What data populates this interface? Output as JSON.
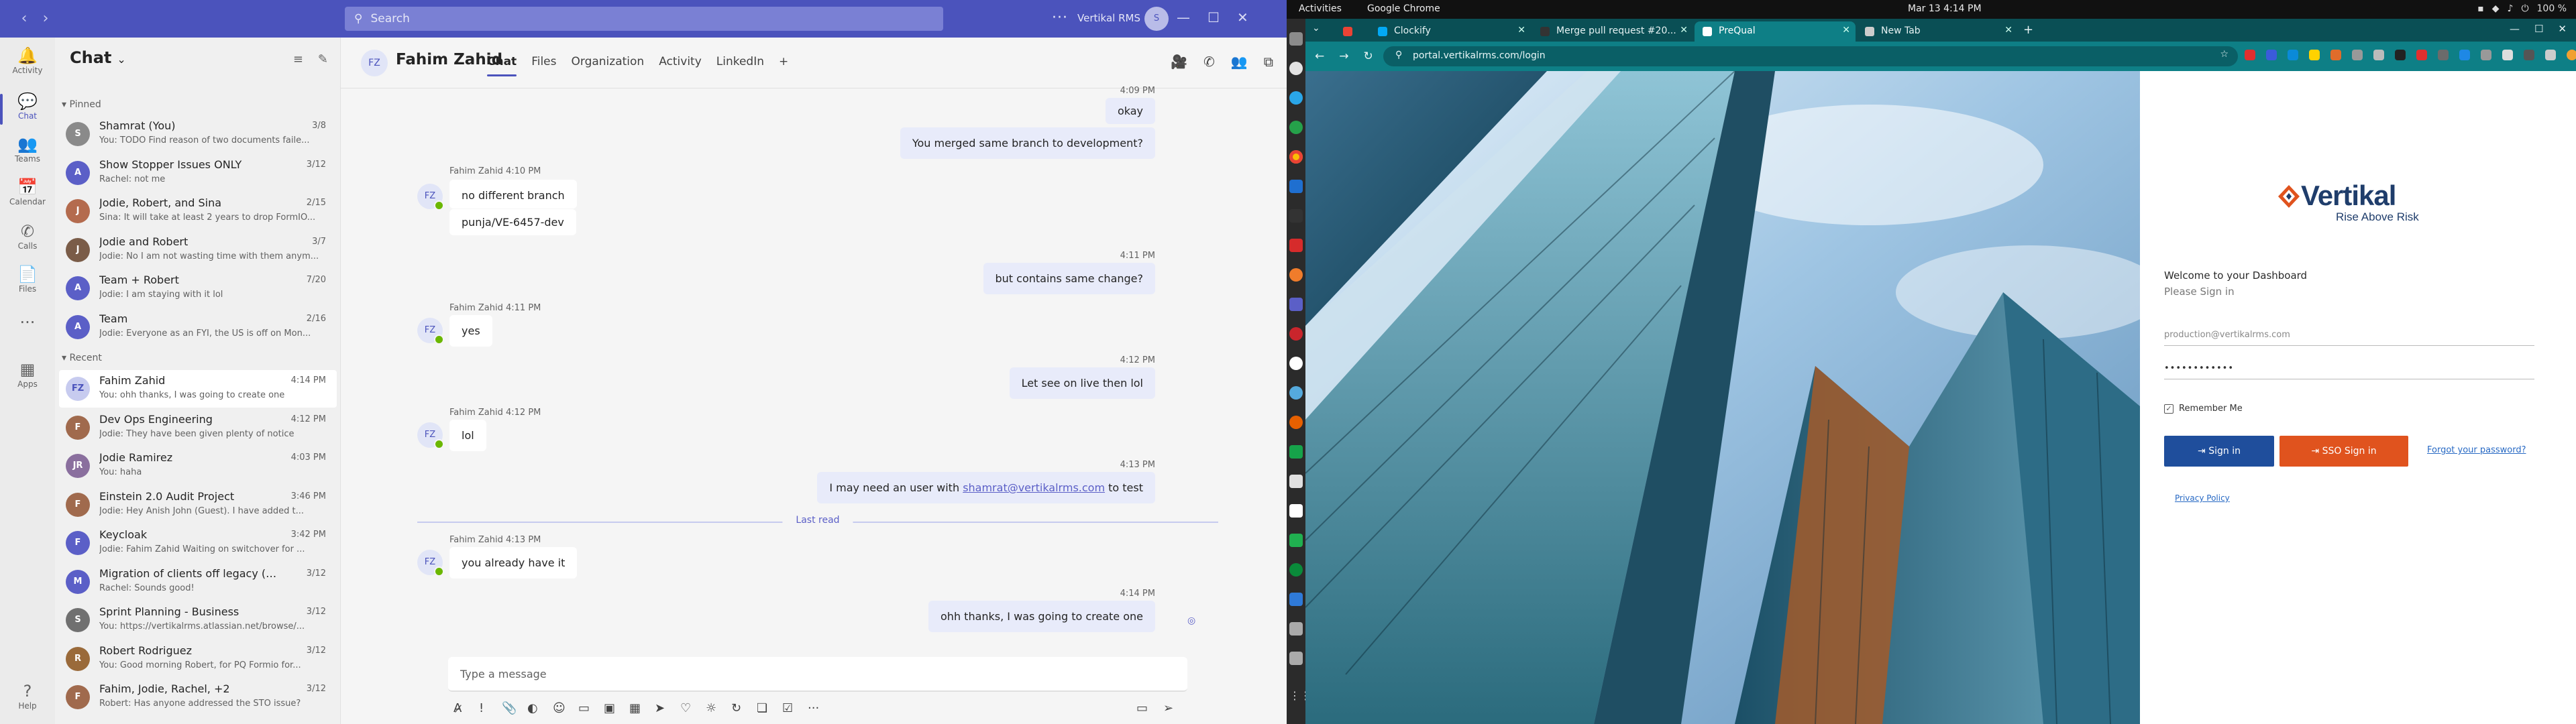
{
  "teams": {
    "search_placeholder": "Search",
    "org_name": "Vertikal RMS",
    "more": "···",
    "rail": [
      {
        "label": "Activity",
        "icon": "bell-icon"
      },
      {
        "label": "Chat",
        "icon": "chat-icon"
      },
      {
        "label": "Teams",
        "icon": "teams-icon"
      },
      {
        "label": "Calendar",
        "icon": "calendar-icon"
      },
      {
        "label": "Calls",
        "icon": "phone-icon"
      },
      {
        "label": "Files",
        "icon": "file-icon"
      },
      {
        "label": "",
        "icon": "more-icon"
      },
      {
        "label": "Apps",
        "icon": "apps-icon"
      },
      {
        "label": "Help",
        "icon": "help-icon"
      }
    ],
    "list_title": "Chat",
    "pinned_label": "Pinned",
    "recent_label": "Recent",
    "pinned": [
      {
        "name": "Shamrat (You)",
        "time": "3/8",
        "preview": "You: TODO Find reason of two documents faile...",
        "avatar": "S",
        "color": "#8a8a8a"
      },
      {
        "name": "Show Stopper Issues ONLY",
        "time": "3/12",
        "preview": "Rachel: not me",
        "avatar": "A",
        "color": "#5b5fc7"
      },
      {
        "name": "Jodie, Robert, and Sina",
        "time": "2/15",
        "preview": "Sina: It will take at least 2 years to drop FormIO...",
        "avatar": "J",
        "color": "#b46b4e"
      },
      {
        "name": "Jodie and Robert",
        "time": "3/7",
        "preview": "Jodie: No I am not wasting time with them anym...",
        "avatar": "J",
        "color": "#7a5c48"
      },
      {
        "name": "Team + Robert",
        "time": "7/20",
        "preview": "Jodie: I am staying with it lol",
        "avatar": "A",
        "color": "#5b5fc7"
      },
      {
        "name": "Team",
        "time": "2/16",
        "preview": "Jodie: Everyone as an FYI, the US is off on Mon...",
        "avatar": "A",
        "color": "#5b5fc7"
      }
    ],
    "recent": [
      {
        "name": "Fahim Zahid",
        "time": "4:14 PM",
        "preview": "You: ohh thanks, I was going to create one",
        "avatar": "FZ",
        "color": "#c7cbef",
        "selected": true
      },
      {
        "name": "Dev Ops Engineering",
        "time": "4:12 PM",
        "preview": "Jodie: They have been given plenty of notice",
        "avatar": "F",
        "color": "#a06a4d"
      },
      {
        "name": "Jodie Ramirez",
        "time": "4:03 PM",
        "preview": "You: haha",
        "avatar": "JR",
        "color": "#8a6f9e"
      },
      {
        "name": "Einstein 2.0 Audit Project",
        "time": "3:46 PM",
        "preview": "Jodie: Hey Anish John (Guest). I have added t...",
        "avatar": "F",
        "color": "#a06a4d"
      },
      {
        "name": "Keycloak",
        "time": "3:42 PM",
        "preview": "Jodie: Fahim Zahid Waiting on switchover for ...",
        "avatar": "F",
        "color": "#5b5fc7"
      },
      {
        "name": "Migration of clients off legacy (sunse...",
        "time": "3/12",
        "preview": "Rachel: Sounds good!",
        "avatar": "M",
        "color": "#5b5fc7"
      },
      {
        "name": "Sprint Planning - Business",
        "time": "3/12",
        "preview": "You: https://vertikalrms.atlassian.net/browse/...",
        "avatar": "S",
        "color": "#707070"
      },
      {
        "name": "Robert Rodriguez",
        "time": "3/12",
        "preview": "You: Good morning Robert, for PQ Formio for...",
        "avatar": "R",
        "color": "#9a6a3a"
      },
      {
        "name": "Fahim, Jodie, Rachel, +2",
        "time": "3/12",
        "preview": "Robert: Has anyone addressed the STO issue?",
        "avatar": "F",
        "color": "#a06a4d"
      }
    ],
    "conversation": {
      "avatar": "FZ",
      "name": "Fahim Zahid",
      "tabs": [
        "Chat",
        "Files",
        "Organization",
        "Activity",
        "LinkedIn"
      ],
      "add_tab": "+",
      "messages": {
        "m1_time": "4:09 PM",
        "m1": "okay",
        "m2": "You merged same branch to development?",
        "m3_meta": "Fahim Zahid  4:10 PM",
        "m3a": "no different branch",
        "m3b": "punja/VE-6457-dev",
        "m4_time": "4:11 PM",
        "m4": "but contains same change?",
        "m5_meta": "Fahim Zahid  4:11 PM",
        "m5": "yes",
        "m6_time": "4:12 PM",
        "m6": "Let see on live then lol",
        "m7_meta": "Fahim Zahid  4:12 PM",
        "m7": "lol",
        "m8_time": "4:13 PM",
        "m8_pre": "I may need an user with ",
        "m8_link": "shamrat@vertikalrms.com",
        "m8_post": " to test",
        "m9_meta": "Fahim Zahid  4:13 PM",
        "m9": "you already have it",
        "m10_time": "4:14 PM",
        "m10": "ohh thanks, I was going to create one"
      },
      "last_read": "Last read",
      "compose_placeholder": "Type a message"
    }
  },
  "system": {
    "activities": "Activities",
    "app": "Google Chrome",
    "clock": "Mar 13  4:14 PM",
    "battery": "100 %"
  },
  "chrome": {
    "tabs": [
      {
        "title": "",
        "color": "#ea4335"
      },
      {
        "title": "Clockify",
        "color": "#03a9f4"
      },
      {
        "title": "Merge pull request #20...",
        "color": "#333333"
      },
      {
        "title": "PreQual",
        "color": "#ffffff"
      },
      {
        "title": "New Tab",
        "color": "#cccccc"
      }
    ],
    "active_tab_index": 3,
    "new_tab": "+",
    "url": "portal.vertikalrms.com/login"
  },
  "login": {
    "logo_word": "Vertikal",
    "tagline": "Rise Above Risk",
    "welcome": "Welcome to your Dashboard",
    "please": "Please Sign in",
    "email": "production@vertikalrms.com",
    "password": "••••••••••••",
    "remember": "Remember Me",
    "sign_in": "Sign in",
    "sso_sign_in": "SSO Sign in",
    "forgot": "Forgot your password?",
    "privacy": "Privacy Policy",
    "colors": {
      "sign_in": "#1f4e9c",
      "sso": "#e0531e",
      "brand": "#1f3d6b"
    }
  }
}
